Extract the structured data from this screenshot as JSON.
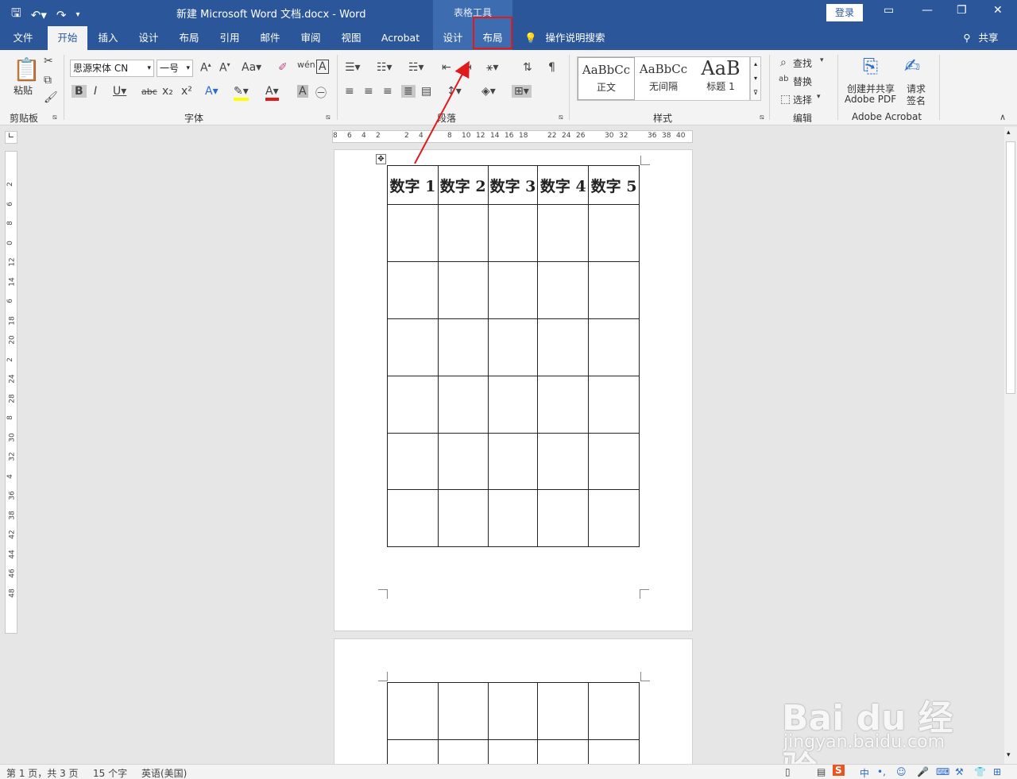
{
  "titlebar": {
    "title": "新建 Microsoft Word 文档.docx  -  Word",
    "context_group": "表格工具",
    "login": "登录"
  },
  "tabs": {
    "file": "文件",
    "home": "开始",
    "insert": "插入",
    "design": "设计",
    "layout": "布局",
    "references": "引用",
    "mailings": "邮件",
    "review": "审阅",
    "view": "视图",
    "acrobat": "Acrobat",
    "table_design": "设计",
    "table_layout": "布局",
    "tell_me": "操作说明搜索",
    "share": "共享"
  },
  "ribbon": {
    "clipboard": {
      "paste": "粘贴",
      "label": "剪贴板"
    },
    "font": {
      "font_name": "思源宋体 CN",
      "font_size": "一号",
      "label": "字体"
    },
    "paragraph": {
      "label": "段落"
    },
    "styles": {
      "label": "样式",
      "items": [
        {
          "sample": "AaBbCc",
          "name": "正文"
        },
        {
          "sample": "AaBbCc",
          "name": "无间隔"
        },
        {
          "sample": "AaB",
          "name": "标题 1"
        }
      ]
    },
    "editing": {
      "find": "查找",
      "replace": "替换",
      "select": "选择",
      "label": "编辑"
    },
    "acrobat": {
      "create_pdf_line1": "创建并共享",
      "create_pdf_line2": "Adobe PDF",
      "request_sign_line1": "请求",
      "request_sign_line2": "签名",
      "label": "Adobe Acrobat"
    }
  },
  "ruler": {
    "h_numbers": [
      "8",
      "6",
      "4",
      "2",
      "2",
      "4",
      "8",
      "10",
      "12",
      "14",
      "16",
      "18",
      "22",
      "24",
      "26",
      "30",
      "32",
      "36",
      "38",
      "40"
    ],
    "v_numbers": [
      "2",
      "6",
      "8",
      "0",
      "12",
      "14",
      "6",
      "18",
      "20",
      "2",
      "24",
      "28",
      "8",
      "30",
      "32",
      "4",
      "36",
      "38",
      "42",
      "44",
      "46",
      "48"
    ]
  },
  "table": {
    "headers": [
      "数字 1",
      "数字 2",
      "数字 3",
      "数字 4",
      "数字 5"
    ]
  },
  "status": {
    "page": "第 1 页，共 3 页",
    "words": "15 个字",
    "lang": "英语(美国)"
  },
  "watermark": {
    "logo": "Bai du 经验",
    "url": "jingyan.baidu.com"
  },
  "colors": {
    "accent": "#2b579a",
    "highlight": "#e01b1b"
  }
}
